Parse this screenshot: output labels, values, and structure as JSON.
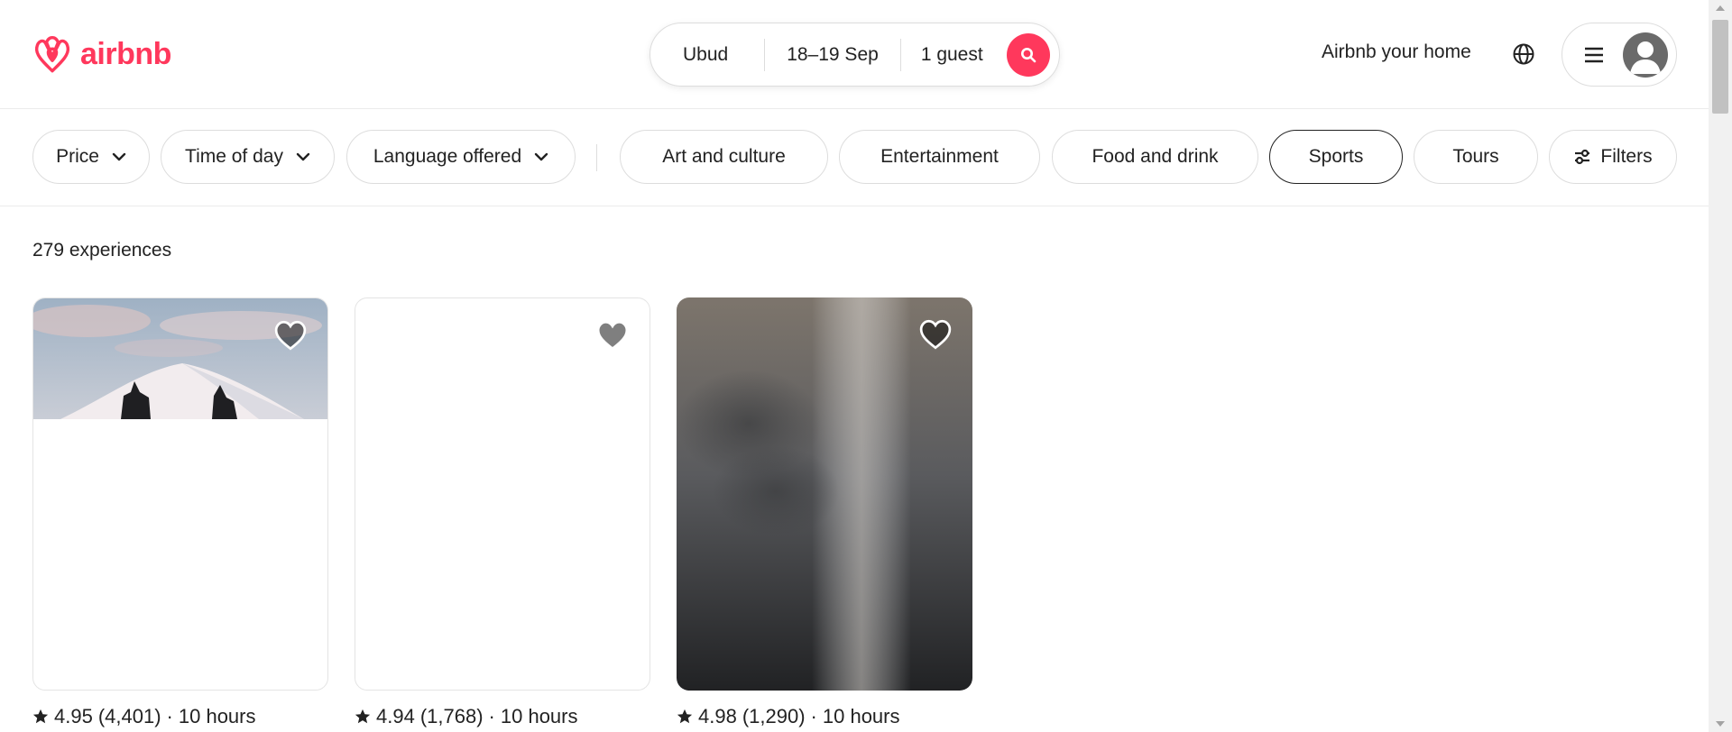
{
  "brand": {
    "name": "airbnb",
    "color": "#ff385c",
    "logo_icon": "airbnb-belo-icon"
  },
  "search": {
    "location": "Ubud",
    "dates": "18–19 Sep",
    "guests": "1 guest",
    "button_icon": "search-icon"
  },
  "header": {
    "host_link": "Airbnb your home",
    "globe_icon": "globe-icon",
    "menu_icon": "hamburger-icon",
    "avatar_icon": "user-avatar-icon"
  },
  "filters": {
    "dropdowns": [
      {
        "label": "Price"
      },
      {
        "label": "Time of day"
      },
      {
        "label": "Language offered"
      }
    ],
    "categories": [
      {
        "label": "Art and culture",
        "selected": false
      },
      {
        "label": "Entertainment",
        "selected": false
      },
      {
        "label": "Food and drink",
        "selected": false
      },
      {
        "label": "Sports",
        "selected": true
      },
      {
        "label": "Tours",
        "selected": false
      }
    ],
    "filters_button": "Filters"
  },
  "results": {
    "count_text": "279 experiences"
  },
  "cards": [
    {
      "rating": "4.95",
      "reviews": "(4,401)",
      "separator": "·",
      "duration": "10 hours",
      "image": "mountain-temple-photo"
    },
    {
      "rating": "4.94",
      "reviews": "(1,768)",
      "separator": "·",
      "duration": "10 hours",
      "image": "blank-loading"
    },
    {
      "rating": "4.98",
      "reviews": "(1,290)",
      "separator": "·",
      "duration": "10 hours",
      "image": "blurred-dark-photo"
    }
  ]
}
